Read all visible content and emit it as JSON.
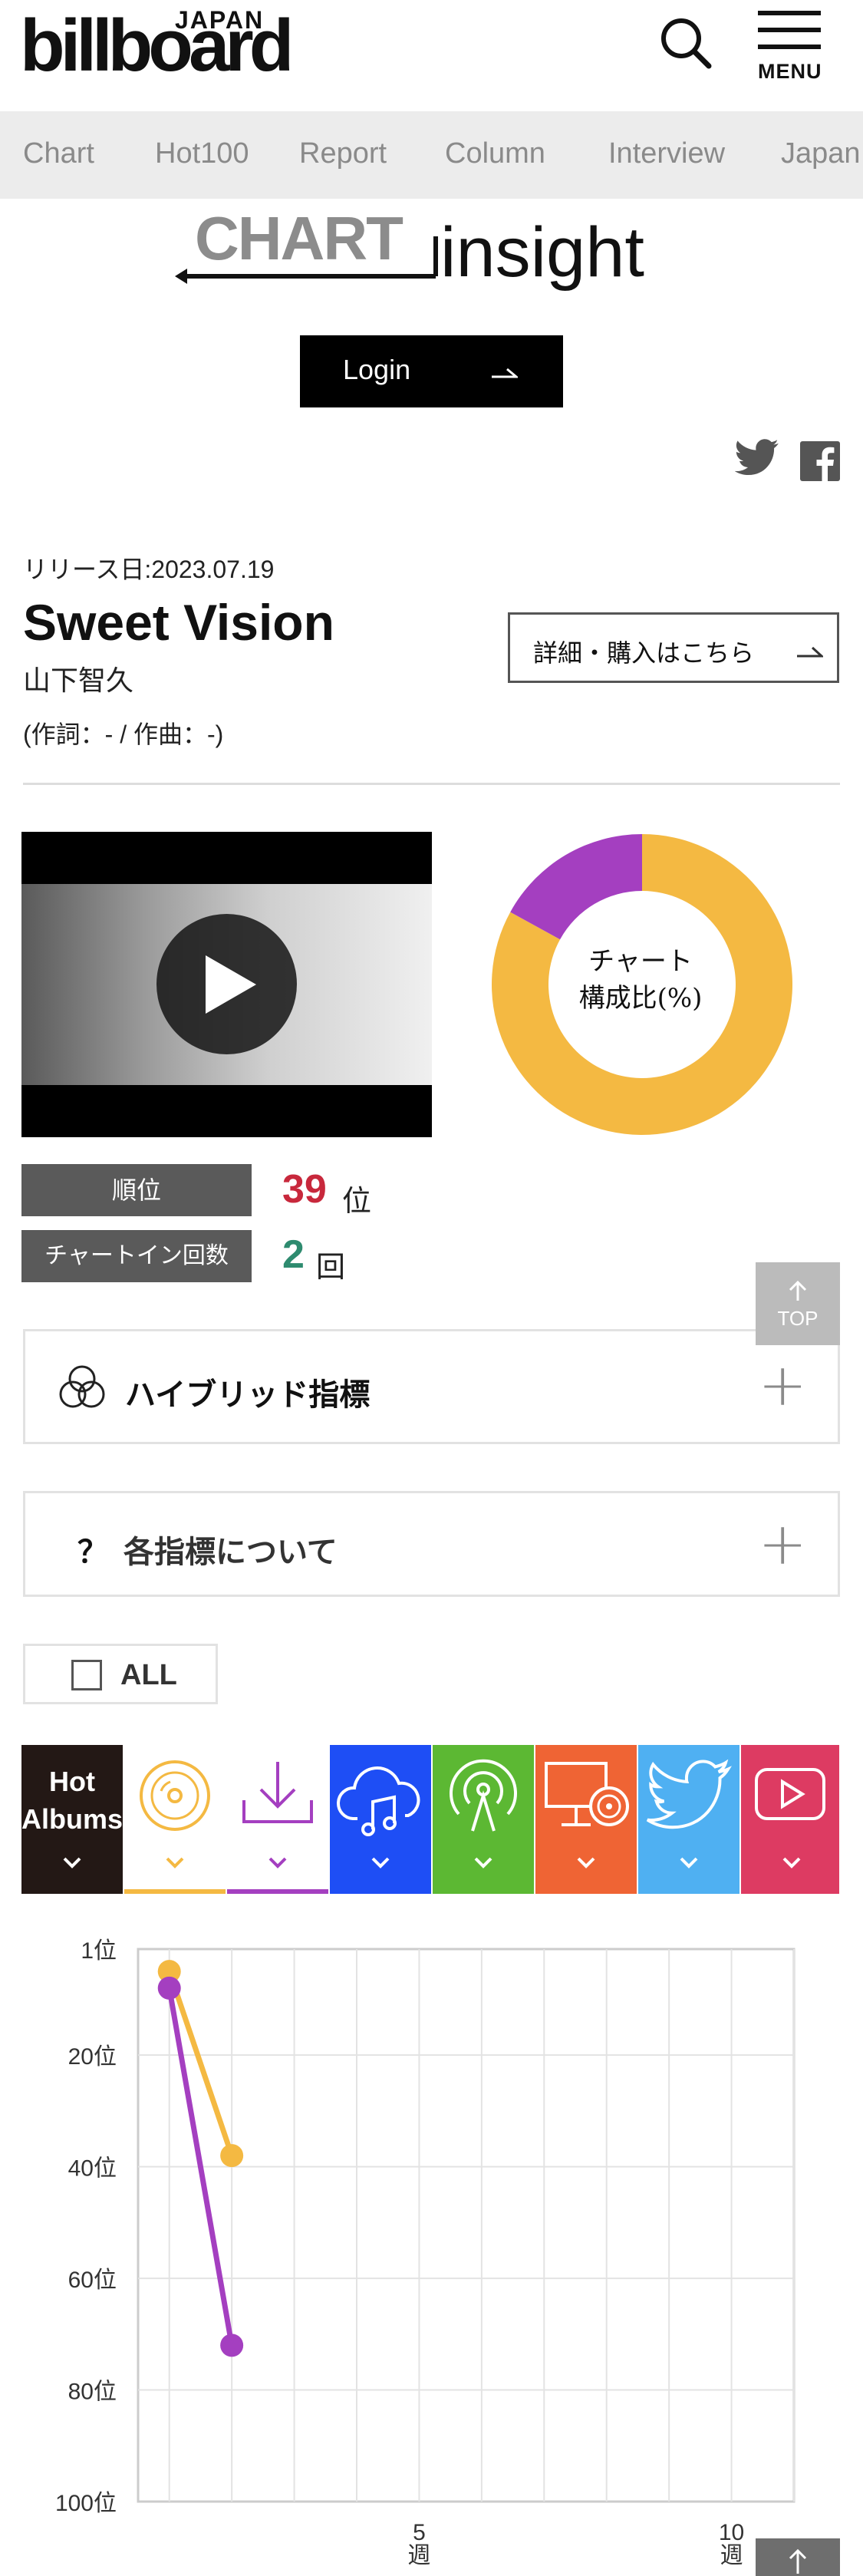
{
  "header": {
    "logo_small": "JAPAN",
    "logo": "billboard",
    "menu_label": "MENU"
  },
  "nav": {
    "items": [
      "Chart",
      "Hot100",
      "Report",
      "Column",
      "Interview",
      "Japan"
    ]
  },
  "brand": {
    "chart_word": "CHART",
    "insight_word": "insight"
  },
  "login_label": "Login",
  "song": {
    "release": "リリース日:2023.07.19",
    "title": "Sweet Vision",
    "artist": "山下智久",
    "credit": "(作詞：- / 作曲：-)",
    "buy_label": "詳細・購入はこちら"
  },
  "donut": {
    "label_line1": "チャート",
    "label_line2": "構成比(%)"
  },
  "stats": {
    "rank_label": "順位",
    "rank_value": "39",
    "rank_unit": "位",
    "chartin_label": "チャートイン回数",
    "chartin_value": "2",
    "chartin_unit": "回"
  },
  "top_button_label": "TOP",
  "accordions": {
    "hybrid": "ハイブリッド指標",
    "about_mark": "？",
    "about": "各指標について"
  },
  "all_label": "ALL",
  "tabs": {
    "hot_albums_line1": "Hot",
    "hot_albums_line2": "Albums"
  },
  "colors": {
    "sales": "#f4b942",
    "download": "#a43fc0",
    "streaming": "#1e4ef5",
    "radio": "#5cb833",
    "lookup": "#ef6434",
    "twitter": "#4fb0f2",
    "video": "#dd3b62",
    "rank": "#c8283c",
    "count": "#2e8b6f"
  },
  "chart_data": [
    {
      "type": "pie",
      "categories": [
        "sales",
        "download"
      ],
      "values": [
        83,
        17
      ]
    },
    {
      "type": "line",
      "yaxis_ticks": [
        "1位",
        "20位",
        "40位",
        "60位",
        "80位",
        "100位"
      ],
      "xaxis_ticks": [
        {
          "week": 5,
          "line1": "5",
          "line2": "週"
        },
        {
          "week": 10,
          "line1": "10",
          "line2": "週"
        }
      ],
      "ylim": [
        1,
        100
      ],
      "xlim": [
        0.5,
        11
      ],
      "y_inverted": true,
      "grid": true,
      "series": [
        {
          "key": "sales",
          "values": [
            [
              1,
              5
            ],
            [
              2,
              38
            ]
          ]
        },
        {
          "key": "download",
          "values": [
            [
              1,
              8
            ],
            [
              2,
              72
            ]
          ]
        }
      ]
    }
  ]
}
